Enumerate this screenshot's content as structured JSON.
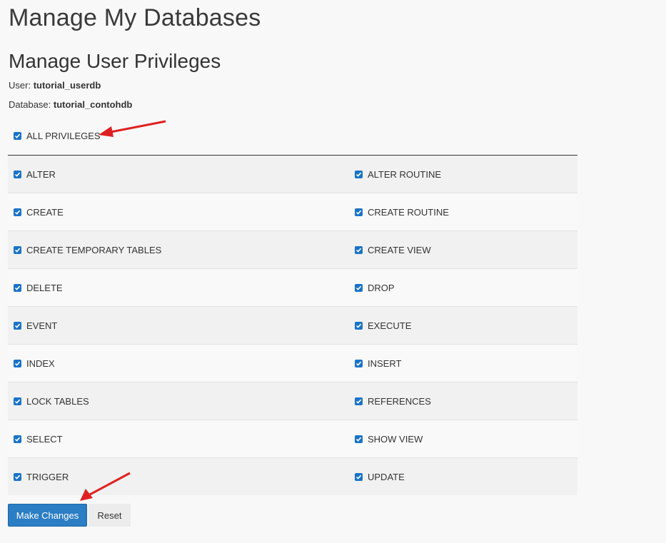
{
  "page": {
    "title": "Manage My Databases",
    "section_title": "Manage User Privileges"
  },
  "meta": {
    "user_label": "User:",
    "user_value": "tutorial_userdb",
    "database_label": "Database:",
    "database_value": "tutorial_contohdb"
  },
  "all_privileges": {
    "label": "ALL PRIVILEGES",
    "checked": true
  },
  "privileges": [
    {
      "left": "ALTER",
      "right": "ALTER ROUTINE"
    },
    {
      "left": "CREATE",
      "right": "CREATE ROUTINE"
    },
    {
      "left": "CREATE TEMPORARY TABLES",
      "right": "CREATE VIEW"
    },
    {
      "left": "DELETE",
      "right": "DROP"
    },
    {
      "left": "EVENT",
      "right": "EXECUTE"
    },
    {
      "left": "INDEX",
      "right": "INSERT"
    },
    {
      "left": "LOCK TABLES",
      "right": "REFERENCES"
    },
    {
      "left": "SELECT",
      "right": "SHOW VIEW"
    },
    {
      "left": "TRIGGER",
      "right": "UPDATE"
    }
  ],
  "buttons": {
    "make_changes": "Make Changes",
    "reset": "Reset"
  },
  "colors": {
    "accent": "#2b7dc4",
    "checkbox": "#1a73c8",
    "annotation_arrow": "#e02020"
  }
}
